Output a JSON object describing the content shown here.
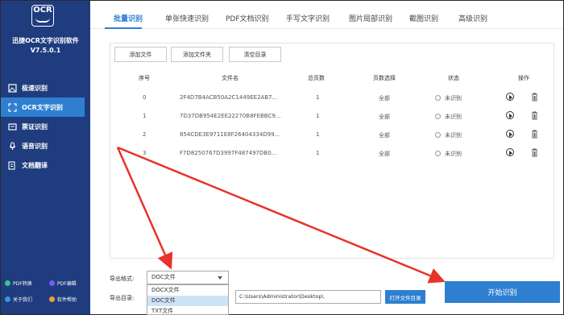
{
  "app": {
    "logo_text": "OCR",
    "name": "迅捷OCR文字识别软件",
    "version": "V7.5.0.1"
  },
  "sidebar": {
    "items": [
      {
        "label": "极速识别",
        "icon": "image-icon",
        "active": false
      },
      {
        "label": "OCR文字识别",
        "icon": "scan-icon",
        "active": true
      },
      {
        "label": "票证识别",
        "icon": "ticket-icon",
        "active": false
      },
      {
        "label": "语音识别",
        "icon": "microphone-icon",
        "active": false
      },
      {
        "label": "文档翻译",
        "icon": "translate-icon",
        "active": false
      }
    ],
    "bottom_links": [
      {
        "label": "PDF转换",
        "color": "#3ec28f"
      },
      {
        "label": "PDF编辑",
        "color": "#7a5cf0"
      },
      {
        "label": "关于我们",
        "color": "#2f9be0"
      },
      {
        "label": "软件帮助",
        "color": "#f0a030"
      }
    ]
  },
  "tabs": [
    "批量识别",
    "单张快速识别",
    "PDF文档识别",
    "手写文字识别",
    "图片局部识别",
    "截图识别",
    "高级识别"
  ],
  "toolbar": {
    "add_file": "添加文件",
    "add_folder": "添加文件夹",
    "clear_list": "清空目录"
  },
  "table": {
    "headers": [
      "序号",
      "文件名",
      "总页数",
      "页数选择",
      "状态",
      "操作"
    ],
    "rows": [
      {
        "index": "0",
        "filename": "2F4D7B4ACB50A2C1449EE2AB7...",
        "pages": "1",
        "page_select": "全部",
        "status": "未识别"
      },
      {
        "index": "1",
        "filename": "7D37DB954E2EE22270B8FEBBC9...",
        "pages": "1",
        "page_select": "全部",
        "status": "未识别"
      },
      {
        "index": "2",
        "filename": "854CDE3E9711E8F26404334D99...",
        "pages": "1",
        "page_select": "全部",
        "status": "未识别"
      },
      {
        "index": "3",
        "filename": "F7D8250767D3997F487497DB0...",
        "pages": "1",
        "page_select": "全部",
        "status": "未识别"
      }
    ]
  },
  "export": {
    "format_label": "导出格式:",
    "format_value": "DOC文件",
    "format_options": [
      "DOCX文件",
      "DOC文件",
      "TXT文件"
    ],
    "dir_label": "导出目录:",
    "dir_value": "C:\\Users\\Administrator\\Desktop\\",
    "open_dir": "打开文件目录",
    "start": "开始识别"
  },
  "colors": {
    "sidebar_bg": "#1f3c7e",
    "accent": "#2f7fd1",
    "arrow": "#e8322a"
  }
}
